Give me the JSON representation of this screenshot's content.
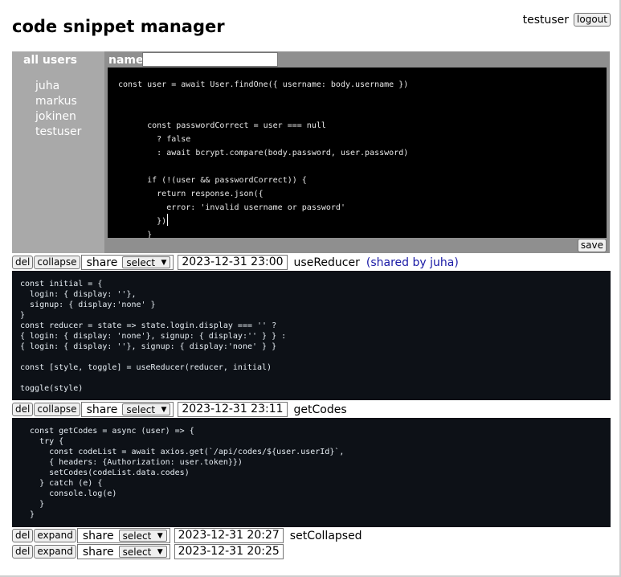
{
  "app": {
    "title": "code snippet manager"
  },
  "user": {
    "name": "testuser",
    "logout_label": "logout"
  },
  "sidebar": {
    "title": "all users",
    "users": [
      "juha",
      "markus",
      "jokinen",
      "testuser"
    ]
  },
  "editor": {
    "name_label": "name",
    "name_value": "",
    "save_label": "save",
    "code_lines": [
      "const user = await User.findOne({ username: body.username })",
      "",
      "",
      "      const passwordCorrect = user === null",
      "        ? false",
      "        : await bcrypt.compare(body.password, user.password)",
      "",
      "      if (!(user && passwordCorrect)) {",
      "        return response.json({",
      "          error: 'invalid username or password'",
      "        })",
      "      }"
    ]
  },
  "snippets": [
    {
      "del_label": "del",
      "toggle_label": "collapse",
      "share_label": "share",
      "select_value": "select",
      "date": "2023-12-31 23:00",
      "title": "useReducer",
      "shared_by": "(shared by juha)",
      "code": "const initial = {\n  login: { display: ''},\n  signup: { display:'none' }\n}\nconst reducer = state => state.login.display === '' ?\n{ login: { display: 'none'}, signup: { display:'' } } :\n{ login: { display: ''}, signup: { display:'none' } }\n\nconst [style, toggle] = useReducer(reducer, initial)\n\ntoggle(style)"
    },
    {
      "del_label": "del",
      "toggle_label": "collapse",
      "share_label": "share",
      "select_value": "select",
      "date": "2023-12-31 23:11",
      "title": "getCodes",
      "shared_by": "",
      "code": "  const getCodes = async (user) => {\n    try {\n      const codeList = await axios.get(`/api/codes/${user.userId}`,\n      { headers: {Authorization: user.token}})\n      setCodes(codeList.data.codes)\n    } catch (e) {\n      console.log(e)\n    }\n  }"
    },
    {
      "del_label": "del",
      "toggle_label": "expand",
      "share_label": "share",
      "select_value": "select",
      "date": "2023-12-31 20:27",
      "title": "setCollapsed",
      "shared_by": ""
    },
    {
      "del_label": "del",
      "toggle_label": "expand",
      "share_label": "share",
      "select_value": "select",
      "date": "2023-12-31 20:25",
      "title": "",
      "shared_by": ""
    }
  ]
}
